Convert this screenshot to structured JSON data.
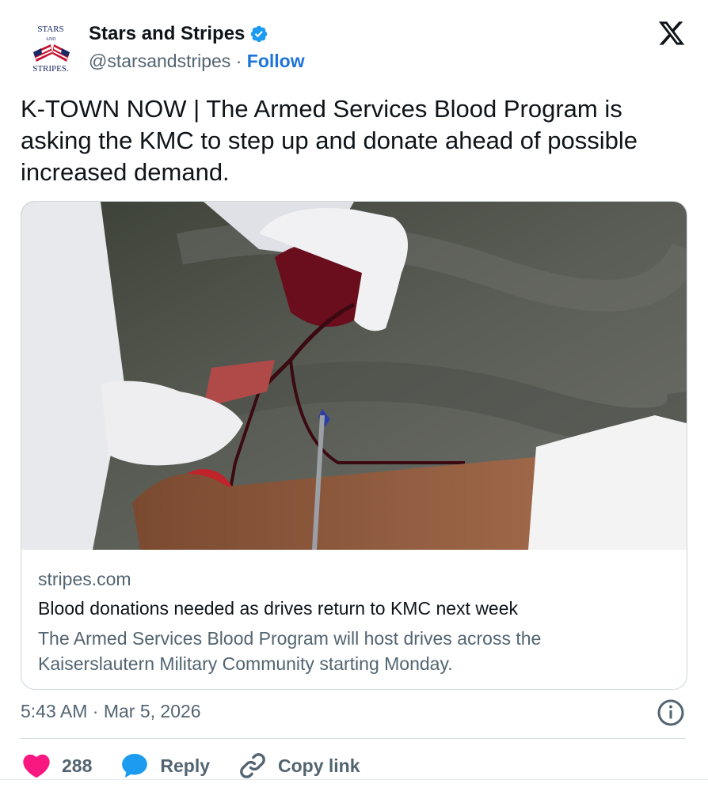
{
  "account": {
    "logo_text_top": "STARS",
    "logo_text_mid": "AND",
    "logo_text_bottom": "STRIPES.",
    "display_name": "Stars and Stripes",
    "handle": "@starsandstripes",
    "separator": "·",
    "follow_label": "Follow"
  },
  "tweet": {
    "text": "K-TOWN NOW | The Armed Services Blood Program is asking the KMC to step up and donate ahead of possible increased demand."
  },
  "link_card": {
    "domain": "stripes.com",
    "title": "Blood donations needed as drives return to KMC next week",
    "description": "The Armed Services Blood Program will host drives across the Kaiserslautern Military Community starting Monday."
  },
  "meta": {
    "timestamp": "5:43 AM · Mar 5, 2026"
  },
  "actions": {
    "likes_count": "288",
    "reply_label": "Reply",
    "copy_link_label": "Copy link"
  },
  "colors": {
    "accent": "#1d74d8",
    "like": "#f91880",
    "reply": "#1d9bf0",
    "verified": "#1d9bf0",
    "muted": "#536471"
  }
}
